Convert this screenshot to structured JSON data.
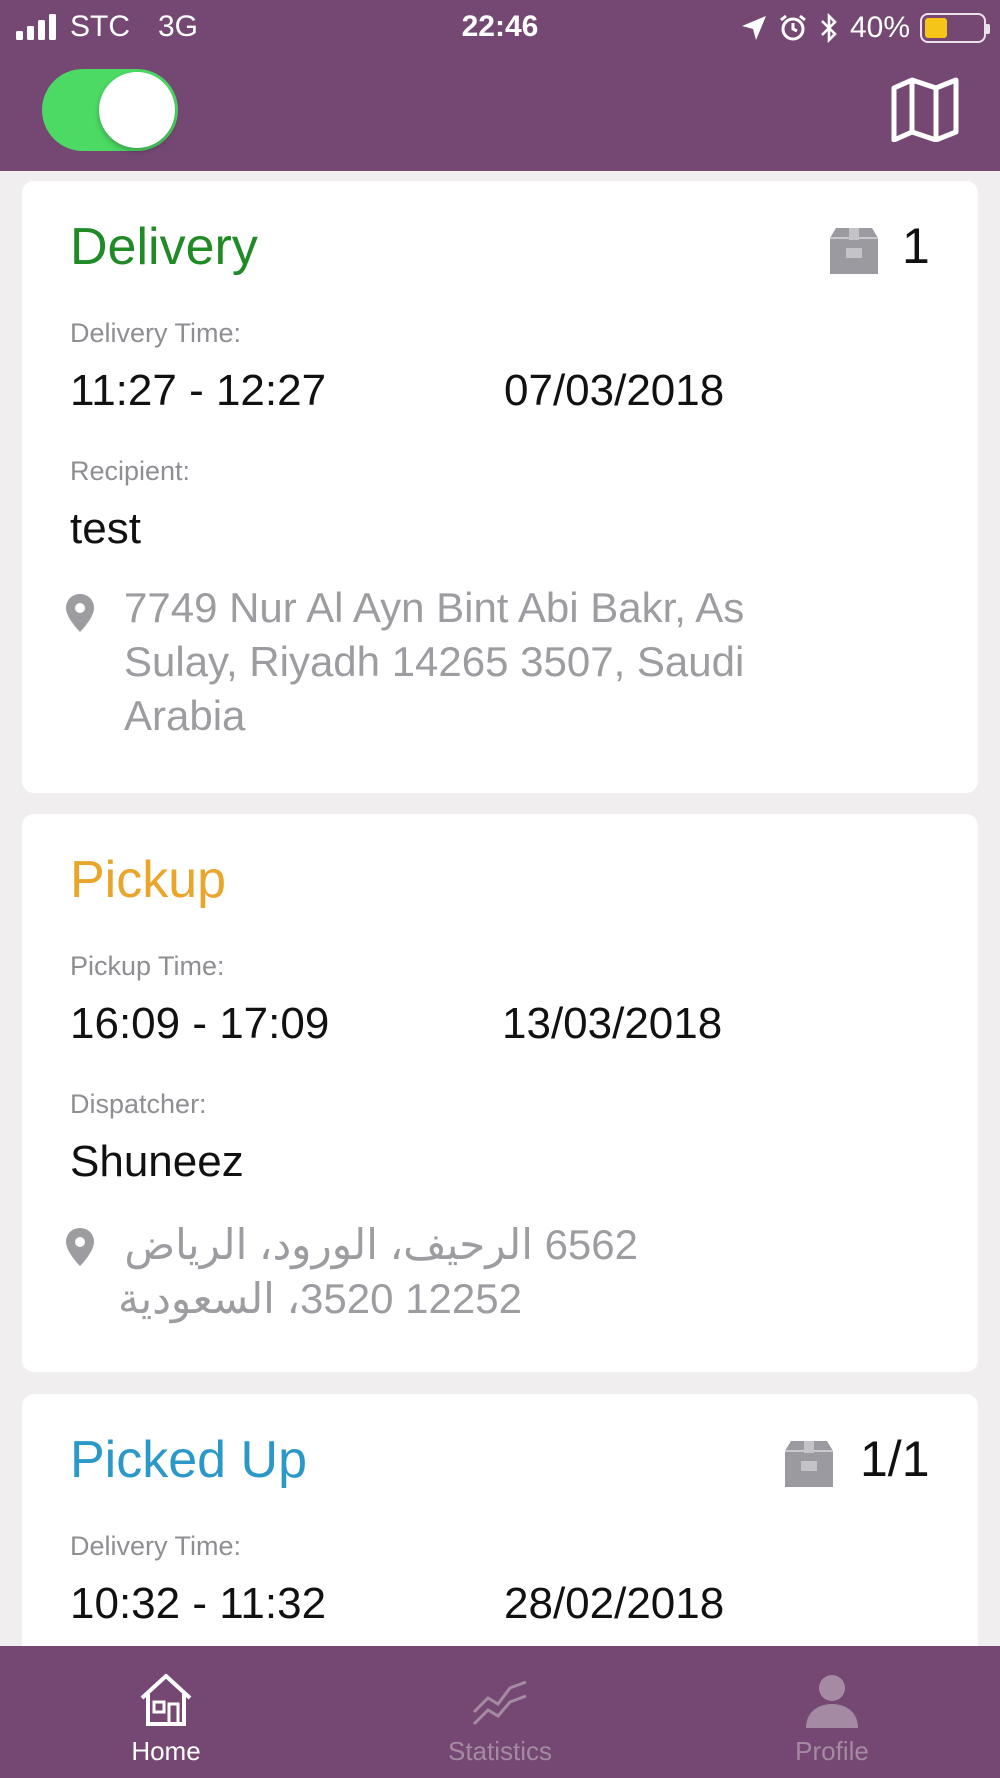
{
  "status_bar": {
    "carrier": "STC",
    "network": "3G",
    "time": "22:46",
    "battery_percent": "40%",
    "battery_level": 0.4
  },
  "header": {
    "toggle_on": true,
    "map_icon": "map-icon"
  },
  "cards": [
    {
      "title": "Delivery",
      "title_color": "#1f8a26",
      "package_count": "1",
      "time_label": "Delivery Time:",
      "time_range": "11:27 - 12:27",
      "date": "07/03/2018",
      "person_label": "Recipient:",
      "person": "test",
      "address_line1": "7749 Nur Al Ayn Bint Abi Bakr, As",
      "address_line2": "Sulay, Riyadh 14265 3507, Saudi",
      "address_line3": "Arabia"
    },
    {
      "title": "Pickup",
      "title_color": "#eaa52b",
      "time_label": "Pickup Time:",
      "time_range": "16:09 - 17:09",
      "date": "13/03/2018",
      "person_label": "Dispatcher:",
      "person": "Shuneez",
      "address_line1": "6562 الرحيف، الورود، الرياض",
      "address_line2": "12252 3520، السعودية"
    },
    {
      "title": "Picked Up",
      "title_color": "#2a98c8",
      "package_count": "1/1",
      "time_label": "Delivery Time:",
      "time_range": "10:32 - 11:32",
      "date": "28/02/2018"
    }
  ],
  "tabs": [
    {
      "label": "Home",
      "icon": "home-icon",
      "active": true
    },
    {
      "label": "Statistics",
      "icon": "statistics-icon",
      "active": false
    },
    {
      "label": "Profile",
      "icon": "profile-icon",
      "active": false
    }
  ]
}
